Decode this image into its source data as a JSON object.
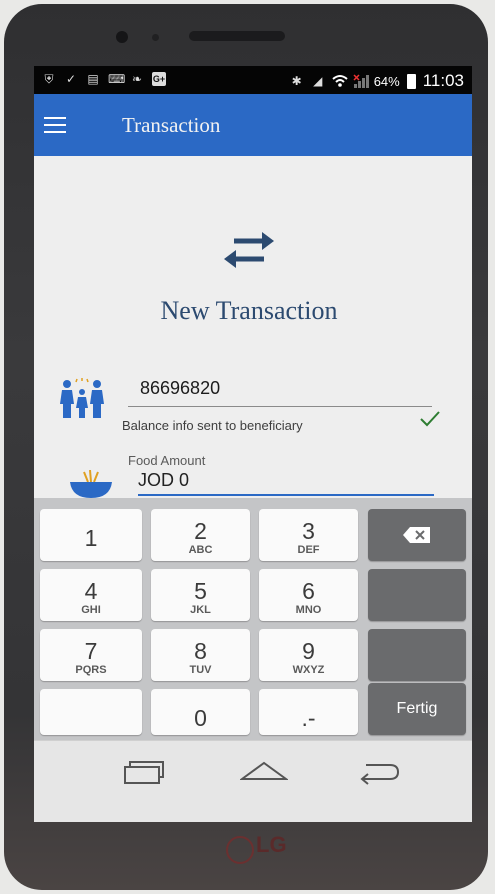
{
  "status_bar": {
    "battery": "64%",
    "time": "11:03",
    "icons": [
      "shield-icon",
      "check-download-icon",
      "message-icon",
      "keyboard-icon",
      "leaf-icon",
      "google-plus-icon",
      "bluetooth-icon",
      "mute-icon",
      "wifi-icon",
      "signal-icon",
      "battery-icon"
    ]
  },
  "app_bar": {
    "title": "Transaction"
  },
  "main": {
    "headline": "New Transaction",
    "beneficiary_id": "86696820",
    "helper_text": "Balance info sent to beneficiary",
    "food_label": "Food Amount",
    "food_value": "JOD 0"
  },
  "keyboard": {
    "keys": [
      {
        "num": "1",
        "letters": ""
      },
      {
        "num": "2",
        "letters": "ABC"
      },
      {
        "num": "3",
        "letters": "DEF"
      },
      {
        "num": "4",
        "letters": "GHI"
      },
      {
        "num": "5",
        "letters": "JKL"
      },
      {
        "num": "6",
        "letters": "MNO"
      },
      {
        "num": "7",
        "letters": "PQRS"
      },
      {
        "num": "8",
        "letters": "TUV"
      },
      {
        "num": "9",
        "letters": "WXYZ"
      },
      {
        "num": "0",
        "letters": ""
      },
      {
        "num": ".-",
        "letters": ""
      }
    ],
    "done_label": "Fertig"
  },
  "device": {
    "brand": "LG"
  },
  "colors": {
    "accent": "#2b69c5",
    "headline": "#2c4a70",
    "success": "#2e7d32"
  }
}
